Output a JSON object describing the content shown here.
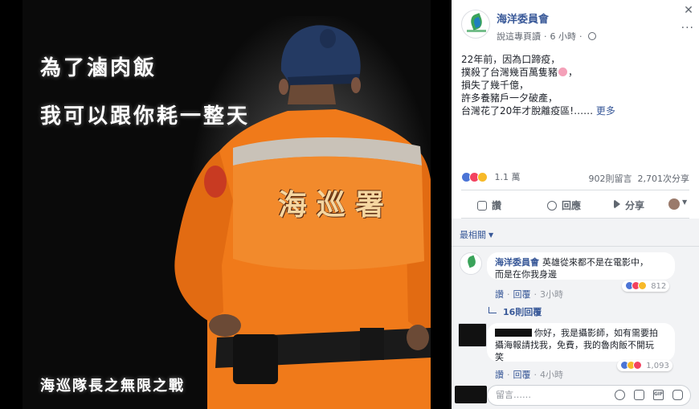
{
  "photo": {
    "headline_line1": "為了滷肉飯",
    "headline_line2": "我可以跟你耗一整天",
    "caption": "海巡隊長之無限之戰",
    "back_patch_text": "海巡署"
  },
  "post": {
    "page_name": "海洋委員會",
    "translate_label": "說這專頁讀",
    "time": "6 小時",
    "body_lines": [
      "22年前，因為口蹄疫，",
      "撲殺了台灣幾百萬隻豬",
      "損失了幾千億，",
      "許多養豬戶一夕破產，",
      "台灣花了20年才脫離疫區!……"
    ],
    "see_more": "更多",
    "reaction_count": "1.1 萬",
    "comment_count": "902則留言",
    "share_count": "2,701次分享",
    "actions": {
      "like": "讚",
      "comment": "回應",
      "share": "分享"
    }
  },
  "comments": {
    "sort_label": "最相關",
    "items": [
      {
        "author": "海洋委員會",
        "text_line1": "英雄從來都不是在電影中，",
        "text_line2": "而是在你我身邊",
        "like": "讚",
        "reply": "回覆",
        "time": "3小時",
        "reactions": "812"
      },
      {
        "text_line1": "你好，我是攝影師，如有需要拍",
        "text_line2": "攝海報請找我，免費，我的魯肉飯不開玩",
        "text_line3": "笑",
        "like": "讚",
        "reply": "回覆",
        "time": "4小時",
        "reactions": "1,093"
      }
    ],
    "replies_toggle": "16則回覆",
    "composer_placeholder": "留言……"
  },
  "colors": {
    "uniform_orange": "#f07a1a",
    "link_blue": "#385898",
    "like_blue": "#4b74d6",
    "love_red": "#f3425f",
    "haha_yellow": "#f7b928"
  }
}
